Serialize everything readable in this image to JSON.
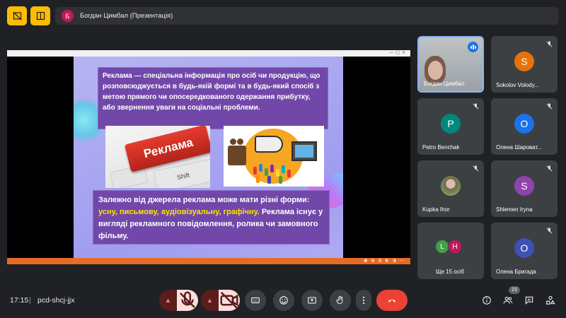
{
  "presenter": {
    "avatar_letter": "Б",
    "title": "Богдан Цимбал (Презентація)"
  },
  "slide": {
    "definition": "Реклама — спеціальна інформація про осіб чи продукцію, що розповсюджується в будь-якій формі та в будь-який спосіб з метою прямого чи опосередкованого одержання прибутку, або звернення уваги на соціальні проблеми.",
    "key_label": "Реклама",
    "shift_label": "Shift",
    "forms_intro": "Залежно від джерела реклама може мати різні форми: ",
    "forms_highlight": "усну, письмову, аудіовізуальну, графічну.",
    "forms_outro": " Реклама існує у вигляді рекламного повідомлення, ролика чи замовного фільму."
  },
  "participants": [
    {
      "name": "Богдан Цимбал",
      "type": "video",
      "speaking": true
    },
    {
      "name": "Sokolov Volody...",
      "letter": "S",
      "color": "#e8710a",
      "muted": true
    },
    {
      "name": "Petro Benchak",
      "letter": "P",
      "color": "#00897b",
      "muted": true
    },
    {
      "name": "Олена Шароват...",
      "letter": "О",
      "color": "#1a73e8",
      "muted": true
    },
    {
      "name": "Kupka Ihor",
      "type": "photo",
      "muted": true
    },
    {
      "name": "Shlemen Iryna",
      "letter": "S",
      "color": "#8e44ad",
      "muted": true
    },
    {
      "name": "Ще 15 осіб",
      "type": "more",
      "letters": [
        "L",
        "H"
      ],
      "colors": [
        "#43a047",
        "#c2185b"
      ]
    },
    {
      "name": "Олена Бригада",
      "letter": "О",
      "color": "#3f51b5",
      "muted": true
    }
  ],
  "bottom": {
    "time": "17:15",
    "separator": "|",
    "meeting_code": "pcd-shcj-jjx",
    "participants_count": "23"
  }
}
